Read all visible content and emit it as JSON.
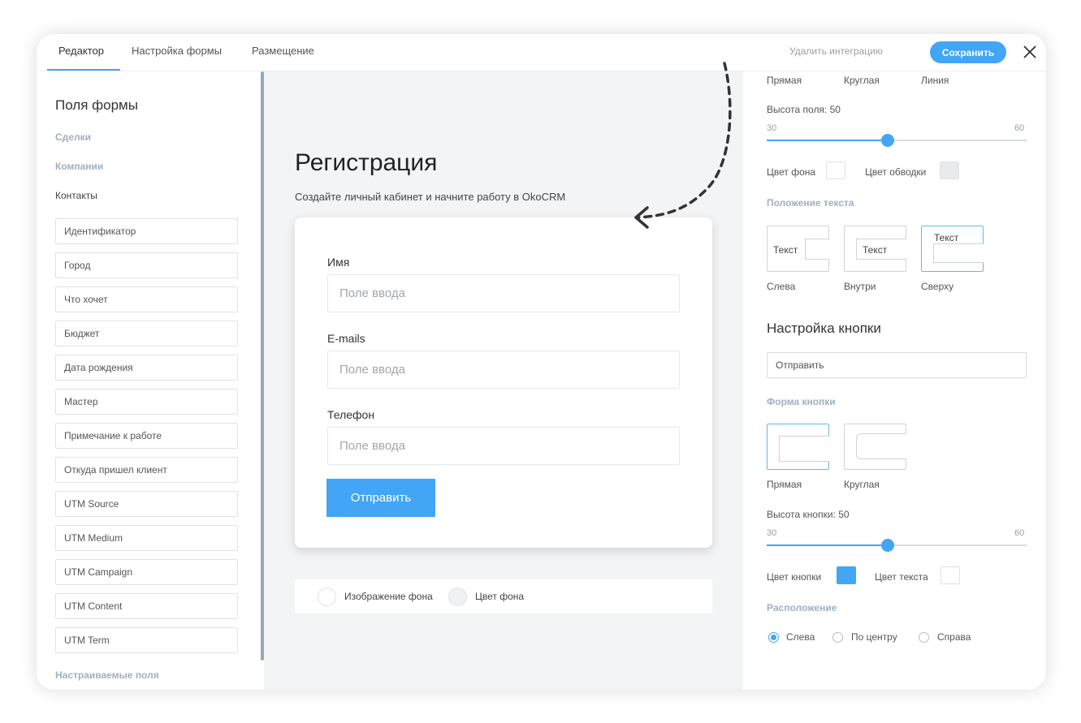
{
  "tabs": [
    {
      "label": "Редактор",
      "active": true
    },
    {
      "label": "Настройка формы",
      "active": false
    },
    {
      "label": "Размещение",
      "active": false
    }
  ],
  "header": {
    "delete_label": "Удалить интеграцию",
    "save_label": "Сохранить",
    "close_icon": "close-icon"
  },
  "sidebar": {
    "title": "Поля формы",
    "categories": [
      "Сделки",
      "Компании",
      "Контакты"
    ],
    "fields": [
      "Идентификатор",
      "Город",
      "Что хочет",
      "Бюджет",
      "Дата рождения",
      "Мастер",
      "Примечание к работе",
      "Откуда пришел клиент",
      "UTM Source",
      "UTM Medium",
      "UTM Campaign",
      "UTM Content",
      "UTM Term"
    ],
    "custom_label": "Настраиваемые поля"
  },
  "preview": {
    "title": "Регистрация",
    "subtitle": "Создайте личный кабинет и начните работу в OkoCRM",
    "fields": [
      {
        "label": "Имя",
        "placeholder": "Поле ввода"
      },
      {
        "label": "E-mails",
        "placeholder": "Поле ввода"
      },
      {
        "label": "Телефон",
        "placeholder": "Поле ввода"
      }
    ],
    "submit_label": "Отправить",
    "bg_options": [
      "Изображение фона",
      "Цвет фона"
    ]
  },
  "settings": {
    "field_shapes": [
      "Прямая",
      "Круглая",
      "Линия"
    ],
    "field_height_label": "Высота поля: 50",
    "field_height": {
      "min": "30",
      "max": "60",
      "value": 50
    },
    "bg_color_label": "Цвет фона",
    "border_color_label": "Цвет обводки",
    "text_position_head": "Положение текста",
    "text_positions": [
      {
        "label": "Слева",
        "sample": "Текст"
      },
      {
        "label": "Внутри",
        "sample": "Текст"
      },
      {
        "label": "Сверху",
        "sample": "Текст"
      }
    ],
    "button_settings_title": "Настройка кнопки",
    "button_text_value": "Отправить",
    "button_shape_head": "Форма кнопки",
    "button_shapes": [
      "Прямая",
      "Круглая"
    ],
    "button_height_label": "Высота кнопки: 50",
    "button_height": {
      "min": "30",
      "max": "60",
      "value": 50
    },
    "button_color_label": "Цвет кнопки",
    "text_color_label": "Цвет текста",
    "alignment_head": "Расположение",
    "alignment_options": [
      "Слева",
      "По центру",
      "Справа"
    ],
    "alignment_selected": "Слева"
  },
  "colors": {
    "accent": "#42a5f5",
    "field_bg": "#ffffff",
    "field_border": "#e8eaed",
    "button_color": "#42a5f5",
    "button_text": "#ffffff",
    "canvas_bg": "#f3f4f6"
  }
}
